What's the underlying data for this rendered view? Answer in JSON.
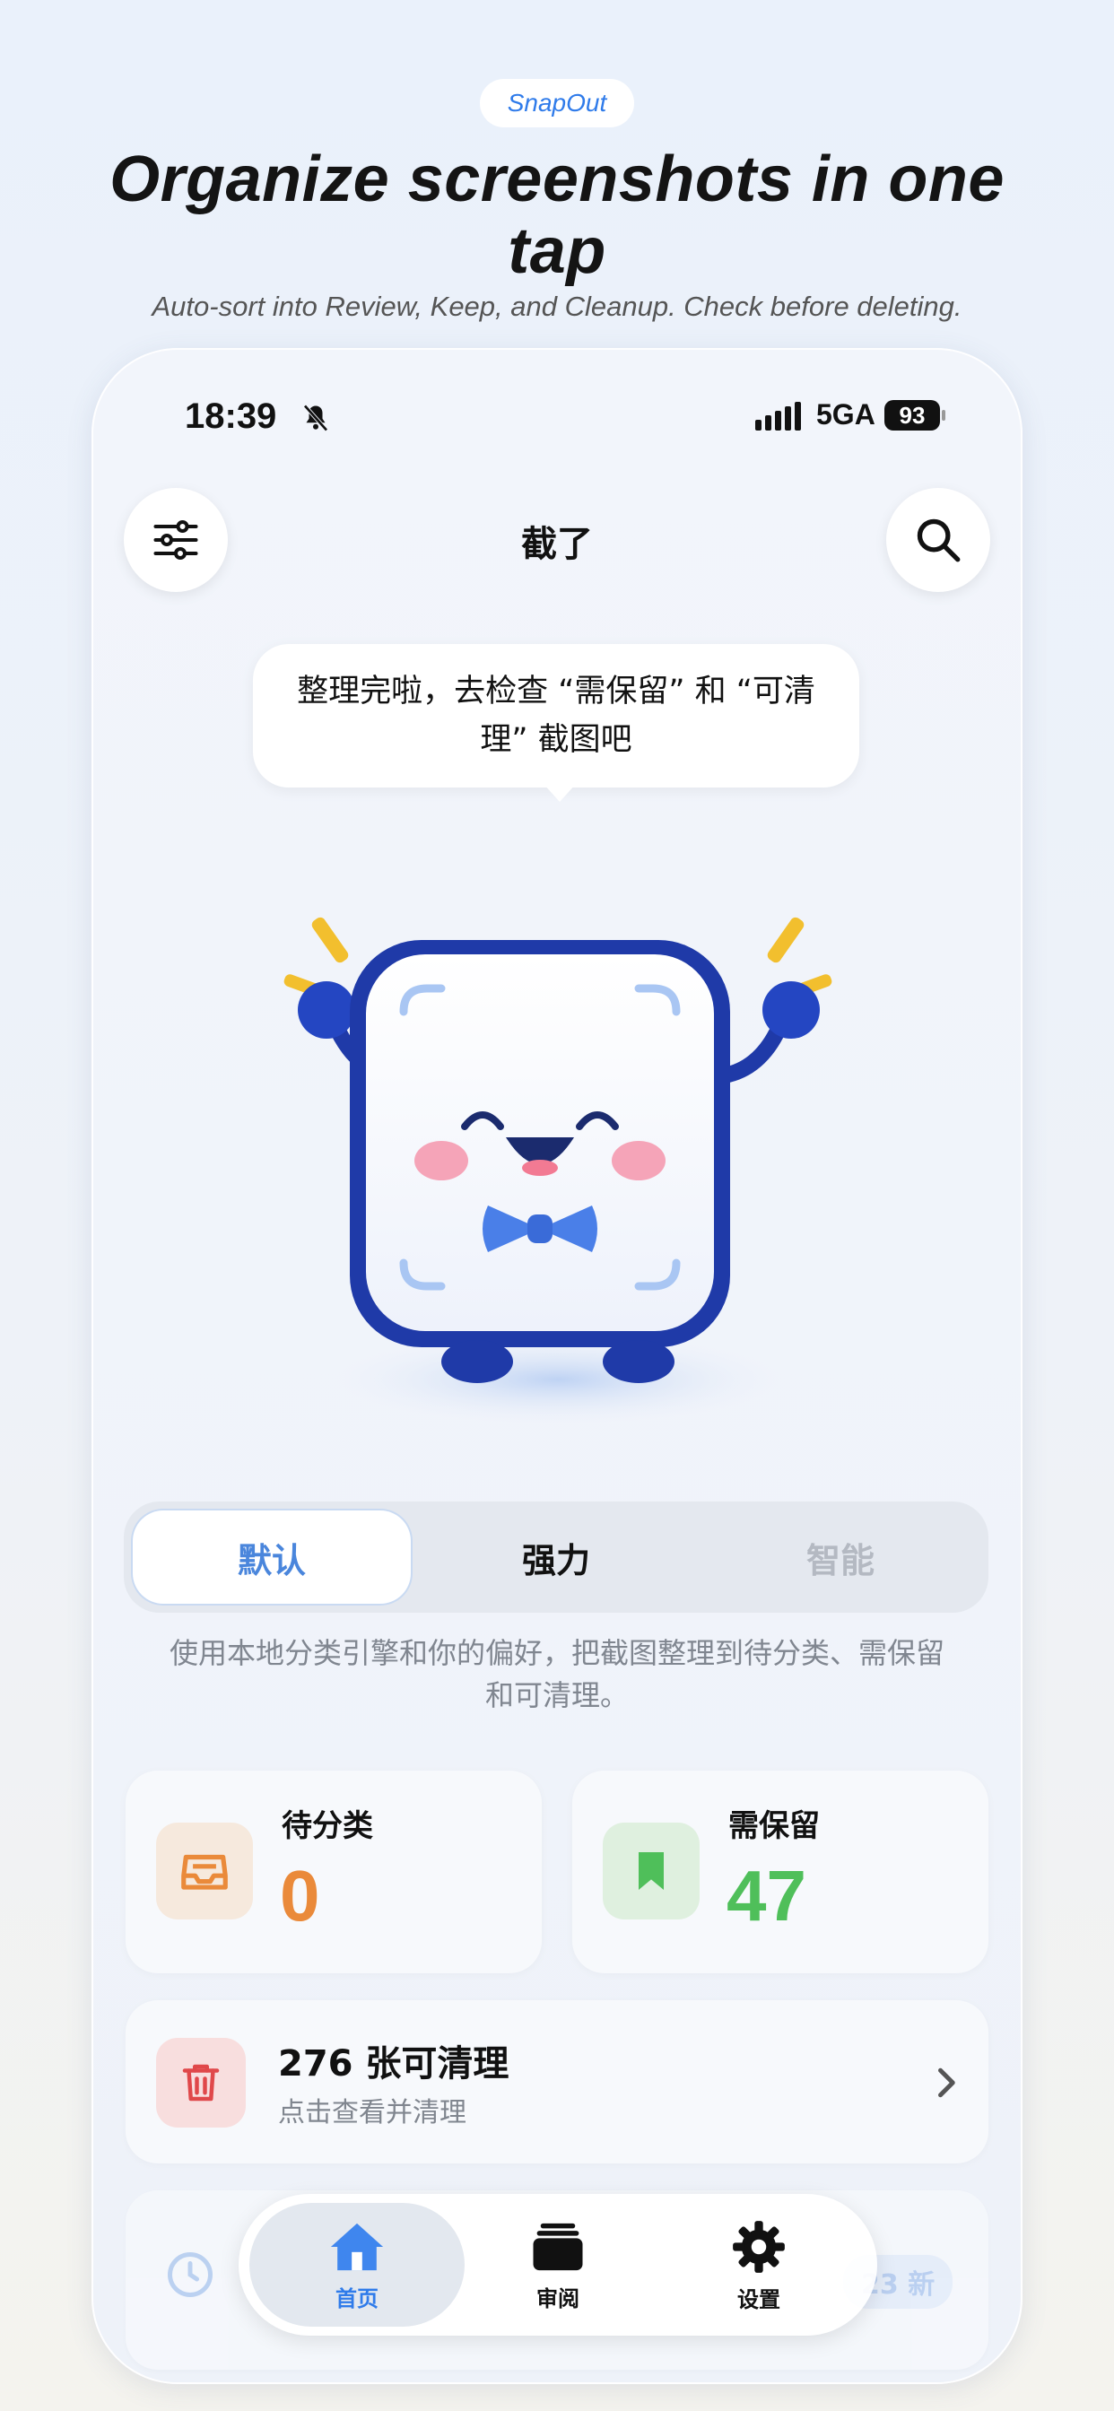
{
  "promo": {
    "brand_pill": "SnapOut",
    "headline": "Organize screenshots in one tap",
    "subline": "Auto-sort into Review, Keep, and Cleanup. Check before deleting."
  },
  "status_bar": {
    "time": "18:39",
    "network": "5GA",
    "battery": "93"
  },
  "header": {
    "title": "截了",
    "filter_icon": "sliders-icon",
    "search_icon": "search-icon"
  },
  "speech_bubble": {
    "text": "整理完啦，去检查 “需保留” 和 “可清理” 截图吧"
  },
  "mode_selector": {
    "options": [
      "默认",
      "强力",
      "智能"
    ],
    "selected": "默认",
    "description": "使用本地分类引擎和你的偏好，把截图整理到待分类、需保留和可清理。"
  },
  "stats": {
    "pending": {
      "label": "待分类",
      "count": "0",
      "icon": "inbox-icon",
      "color": "#ea8a3a"
    },
    "keep": {
      "label": "需保留",
      "count": "47",
      "icon": "bookmark-icon",
      "color": "#4fbf5a"
    }
  },
  "cleanup": {
    "title": "276 张可清理",
    "subtitle": "点击查看并清理",
    "icon": "trash-icon"
  },
  "hidden_card": {
    "badge": "23 新"
  },
  "tab_bar": {
    "items": [
      {
        "label": "首页",
        "icon": "home-icon",
        "active": true
      },
      {
        "label": "审阅",
        "icon": "stack-icon",
        "active": false
      },
      {
        "label": "设置",
        "icon": "gear-icon",
        "active": false
      }
    ]
  },
  "colors": {
    "accent": "#2f7bea",
    "orange": "#ea8a3a",
    "green": "#4fbf5a",
    "red": "#e0484a"
  }
}
